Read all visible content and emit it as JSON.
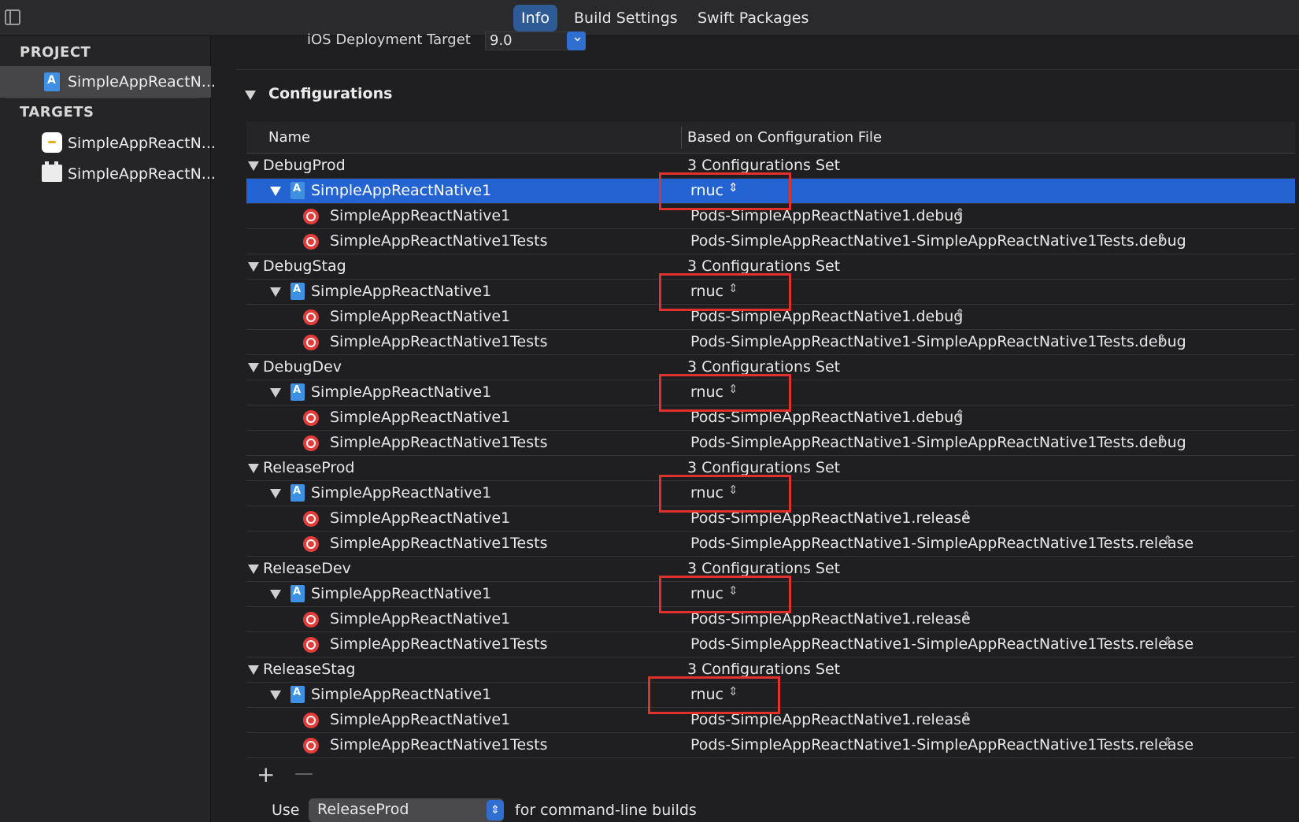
{
  "toolbar": {
    "tabs": [
      {
        "label": "Info",
        "active": true
      },
      {
        "label": "Build Settings",
        "active": false
      },
      {
        "label": "Swift Packages",
        "active": false
      }
    ]
  },
  "sidebar": {
    "project_heading": "PROJECT",
    "project_item": "SimpleAppReactN...",
    "targets_heading": "TARGETS",
    "targets": [
      "SimpleAppReactN...",
      "SimpleAppReactN..."
    ]
  },
  "deployment": {
    "label": "iOS Deployment Target",
    "value": "9.0"
  },
  "configurations": {
    "title": "Configurations",
    "col_name": "Name",
    "col_file": "Based on Configuration File",
    "groups": [
      {
        "name": "DebugProd",
        "summary": "3 Configurations Set",
        "project": "SimpleAppReactNative1",
        "project_file": "rnuc",
        "target1": "SimpleAppReactNative1",
        "target1_file": "Pods-SimpleAppReactNative1.debug",
        "target2": "SimpleAppReactNative1Tests",
        "target2_file": "Pods-SimpleAppReactNative1-SimpleAppReactNative1Tests.debug"
      },
      {
        "name": "DebugStag",
        "summary": "3 Configurations Set",
        "project": "SimpleAppReactNative1",
        "project_file": "rnuc",
        "target1": "SimpleAppReactNative1",
        "target1_file": "Pods-SimpleAppReactNative1.debug",
        "target2": "SimpleAppReactNative1Tests",
        "target2_file": "Pods-SimpleAppReactNative1-SimpleAppReactNative1Tests.debug"
      },
      {
        "name": "DebugDev",
        "summary": "3 Configurations Set",
        "project": "SimpleAppReactNative1",
        "project_file": "rnuc",
        "target1": "SimpleAppReactNative1",
        "target1_file": "Pods-SimpleAppReactNative1.debug",
        "target2": "SimpleAppReactNative1Tests",
        "target2_file": "Pods-SimpleAppReactNative1-SimpleAppReactNative1Tests.debug"
      },
      {
        "name": "ReleaseProd",
        "summary": "3 Configurations Set",
        "project": "SimpleAppReactNative1",
        "project_file": "rnuc",
        "target1": "SimpleAppReactNative1",
        "target1_file": "Pods-SimpleAppReactNative1.release",
        "target2": "SimpleAppReactNative1Tests",
        "target2_file": "Pods-SimpleAppReactNative1-SimpleAppReactNative1Tests.release"
      },
      {
        "name": "ReleaseDev",
        "summary": "3 Configurations Set",
        "project": "SimpleAppReactNative1",
        "project_file": "rnuc",
        "target1": "SimpleAppReactNative1",
        "target1_file": "Pods-SimpleAppReactNative1.release",
        "target2": "SimpleAppReactNative1Tests",
        "target2_file": "Pods-SimpleAppReactNative1-SimpleAppReactNative1Tests.release"
      },
      {
        "name": "ReleaseStag",
        "summary": "3 Configurations Set",
        "project": "SimpleAppReactNative1",
        "project_file": "rnuc",
        "target1": "SimpleAppReactNative1",
        "target1_file": "Pods-SimpleAppReactNative1.release",
        "target2": "SimpleAppReactNative1Tests",
        "target2_file": "Pods-SimpleAppReactNative1-SimpleAppReactNative1Tests.release"
      }
    ],
    "add_glyph": "+",
    "remove_glyph": "—"
  },
  "command_line": {
    "prefix": "Use",
    "value": "ReleaseProd",
    "suffix": "for command-line builds"
  },
  "icons": {
    "sidebar_toggle": "sidebar-toggle-icon",
    "project": "xcode-project-icon",
    "target": "target-icon",
    "popup": "up-down-chevron-icon"
  },
  "colors": {
    "selection": "#2463d2",
    "active_tab": "#2e5b96",
    "highlight_box": "#e0312a",
    "target_icon": "#e43b3b"
  }
}
